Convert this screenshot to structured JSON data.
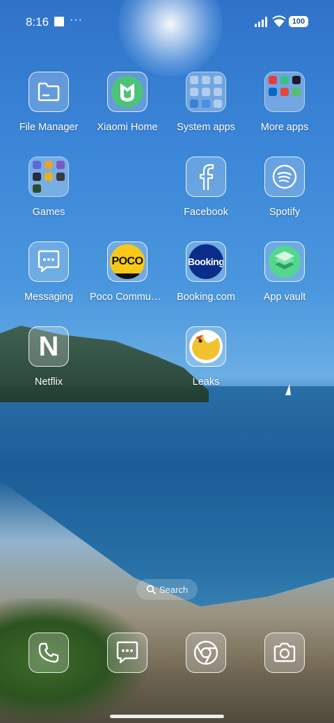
{
  "status_bar": {
    "time": "8:16",
    "more_indicator": "···",
    "battery": "100"
  },
  "apps": {
    "file_manager": "File Manager",
    "xiaomi_home": "Xiaomi Home",
    "system_apps": "System apps",
    "more_apps": "More apps",
    "games": "Games",
    "facebook": "Facebook",
    "spotify": "Spotify",
    "messaging": "Messaging",
    "poco_community": "Poco Communi...",
    "booking": "Booking.com",
    "app_vault": "App vault",
    "netflix": "Netflix",
    "leaks": "Leaks"
  },
  "icon_text": {
    "poco": "POCO",
    "booking": "Booking",
    "netflix": "N"
  },
  "search": {
    "label": "Search"
  },
  "dock": {
    "items": [
      "phone-icon",
      "messages-icon",
      "chrome-icon",
      "camera-icon"
    ]
  },
  "colors": {
    "accent": "#2f73c9",
    "poco_yellow": "#f7c81a",
    "booking_blue": "#0a2d8a",
    "app_vault_green": "#55d690",
    "xiaomi_green": "#4dc37a"
  }
}
